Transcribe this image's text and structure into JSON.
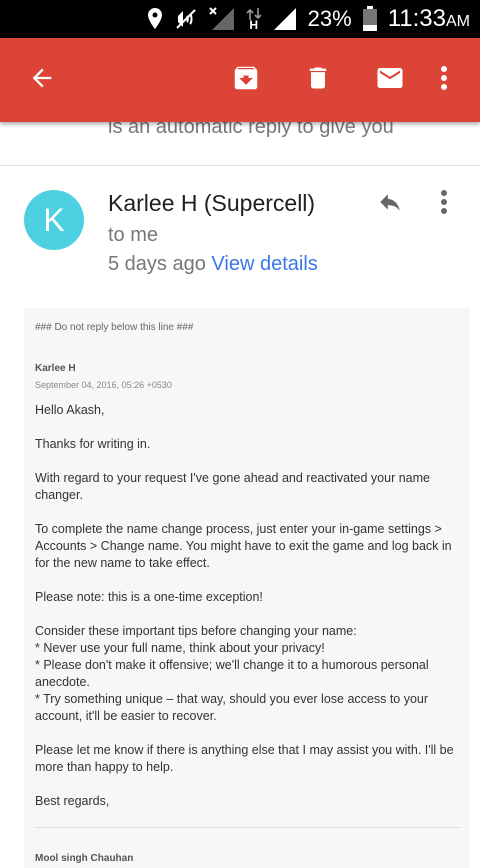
{
  "status_bar": {
    "battery_percent": "23%",
    "time": "11:33",
    "ampm": "AM",
    "network_label": "H",
    "icons": [
      "location-icon",
      "mute-icon",
      "signal-off-icon",
      "data-arrows-icon",
      "signal-icon",
      "battery-icon"
    ]
  },
  "toolbar": {
    "back_icon": "arrow-back-icon",
    "archive_icon": "archive-icon",
    "delete_icon": "trash-icon",
    "mark_unread_icon": "mail-icon",
    "more_icon": "more-vert-icon",
    "background": "#db4437"
  },
  "previous_message_preview": "is an automatic reply to give you",
  "email": {
    "avatar_letter": "K",
    "avatar_color": "#4dd0e1",
    "sender": "Karlee H (Supercell)",
    "recipient": "to me",
    "time_ago": "5 days ago",
    "view_details": "View details",
    "link_color": "#3b78e7",
    "body": {
      "do_not_reply": "### Do not reply below this line ###",
      "author": "Karlee H",
      "date": "September 04, 2016, 05:26 +0530",
      "paragraphs": [
        "Hello Akash,",
        "Thanks for writing in.",
        "With regard to your request I've gone ahead and reactivated your name changer.",
        "To complete the name change process, just enter your in-game settings > Accounts > Change name. You might have to exit the game and log back in for the new name to take effect.",
        "Please note: this is a one-time exception!"
      ],
      "tips_intro": "Consider these important tips before changing your name:",
      "tips": [
        "* Never use your full name, think about your privacy!",
        "* Please don't make it offensive; we'll change it to a humorous personal anecdote.",
        "* Try something unique – that way, should you ever lose access to your account, it'll be easier to recover."
      ],
      "closing_paragraphs": [
        "Please let me know if there is anything else that I may assist you with. I'll be more than happy to help.",
        "Best regards,"
      ],
      "signature": "Mool singh Chauhan"
    }
  }
}
